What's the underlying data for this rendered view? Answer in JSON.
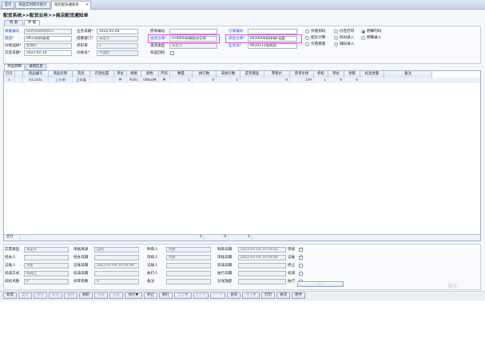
{
  "tabs": [
    "首页",
    "商品实时库存统计",
    "商店配货通知单"
  ],
  "page_title": "配货系统>>配货业务>>商店配货通知单",
  "subtabs": [
    "列 表",
    "单 据"
  ],
  "form": {
    "r1": {
      "l1": "单据编号",
      "v1": "SSPH20000013",
      "l2": "业务日期*",
      "v2": "2022-01-04",
      "l3": "原单编号",
      "v3": "",
      "l4": "订单编号",
      "v4": ""
    },
    "r2": {
      "l1": "渠道*",
      "v1": "0911旧斜渠道",
      "l2": "结算部门*",
      "v2": "未定义",
      "l3": "发货仓库*",
      "v3": "070000末级配货仓库",
      "l4": "调货仓库*",
      "v4": "0010000南阳城F运配"
    },
    "r3": {
      "l1": "价格选择*",
      "v1": "结算价",
      "l2": "折扣率",
      "v2": "1",
      "l3": "发货类型",
      "v3": "未定义",
      "l4": "业务员*",
      "v4": "0010111电商部"
    },
    "r4": {
      "l1": "交货日期*",
      "v1": "2022-01-14",
      "l2": "价格号*",
      "v2": "不选价",
      "l3": "商品回码",
      "v3": ""
    },
    "options": [
      "仅看到码",
      "价签打印",
      "明细列码",
      "配比计算",
      "商码录入",
      "明细录入",
      "仅看数量",
      "辅码录入"
    ]
  },
  "grid_tabs": [
    "商品明细",
    "采购信息"
  ],
  "grid": {
    "headers": [
      "行号",
      "",
      "商品编号",
      "商品名称",
      "简名",
      "存放位置",
      "单位",
      "规格",
      "颜色",
      "尺码",
      "数量",
      "执行数",
      "未执行数",
      "是否赠品",
      "零售价",
      "参考价格",
      "折扣",
      "单价",
      "金额",
      "标准金额",
      "备注"
    ],
    "row": [
      "1",
      "",
      "011101",
      "上衣服",
      "上衣类",
      "",
      "件",
      "A501",
      "000白色",
      "M",
      "1",
      "0",
      "1",
      "",
      "0",
      "159",
      "1",
      "0",
      "0",
      "",
      ""
    ],
    "sum_label": "合计",
    "sum_values": [
      "1",
      "0",
      "1"
    ]
  },
  "bottom": {
    "c1": [
      [
        "实票类型",
        "未定义"
      ],
      [
        "经办人",
        ""
      ],
      [
        "记账人",
        "鸿星"
      ],
      [
        "扣减方式",
        "扣减上"
      ],
      [
        "扣扣点数",
        "0"
      ]
    ],
    "c2": [
      [
        "单据来源",
        "自制"
      ],
      [
        "经办日期",
        ""
      ],
      [
        "记账日期",
        "2022-01-04 10:59:06"
      ],
      [
        "扣减日期",
        ""
      ],
      [
        "扣率系数",
        "0"
      ]
    ],
    "c3": [
      [
        "制单人",
        "鸿星"
      ],
      [
        "审核人",
        "鸿星"
      ],
      [
        "记账人",
        ""
      ],
      [
        "执行人",
        ""
      ],
      [
        "备注",
        ""
      ]
    ],
    "c4": [
      [
        "制单日期",
        "2022-01-04 10:59:02"
      ],
      [
        "审核日期",
        "2022-01-04 10:59:06"
      ],
      [
        "扣减日期",
        ""
      ],
      [
        "执行日期",
        ""
      ],
      [
        "对发放部",
        ""
      ]
    ],
    "c5": [
      "审核",
      "记账",
      "终止",
      "扣减",
      "执行"
    ],
    "more": "..."
  },
  "watermark": "激活",
  "toolbar": [
    "新增",
    "复制",
    "保存",
    "取消",
    "删除",
    "刷新",
    "审核",
    "记账",
    "执行▼",
    "终止",
    "刷行",
    "打印▼",
    "上一个",
    "下一个",
    "查询",
    "导入▼",
    "打印",
    "关闭",
    "附件"
  ],
  "toolbar_enabled": [
    true,
    false,
    false,
    false,
    false,
    true,
    false,
    false,
    true,
    true,
    true,
    false,
    false,
    false,
    true,
    false,
    true,
    true,
    true
  ],
  "colors": {
    "accent": "#1a5bd6",
    "highlight": "#d659e0",
    "tab_active": "#ffffff"
  }
}
